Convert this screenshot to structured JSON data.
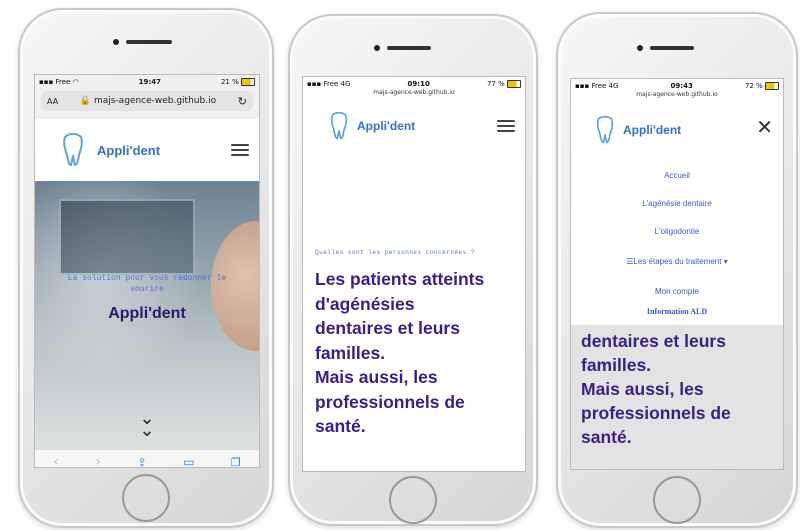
{
  "phone1": {
    "status": {
      "carrier": "Free",
      "time": "19:47",
      "battery": "21 %"
    },
    "address_bar": {
      "text_size": "AA",
      "url": "majs-agence-web.github.io"
    },
    "brand": "Appli'dent",
    "hero": {
      "tagline": "La solution pour vous redonner le sourire",
      "title": "Appli'dent"
    }
  },
  "phone2": {
    "status": {
      "carrier": "Free 4G",
      "time": "09:10",
      "battery": "77 %"
    },
    "url": "majs-agence-web.github.io",
    "brand": "Appli'dent",
    "kicker": "Quelles sont les personnes concernées ?",
    "heading": [
      "Les patients atteints",
      "d'agénésies",
      "dentaires et leurs",
      "familles.",
      "Mais aussi, les",
      "professionnels de",
      "santé."
    ]
  },
  "phone3": {
    "status": {
      "carrier": "Free 4G",
      "time": "09:43",
      "battery": "72 %"
    },
    "url": "majs-agence-web.github.io",
    "brand": "Appli'dent",
    "menu": [
      "Accueil",
      "L'agénésie dentaire",
      "L'oligodontie",
      "Les étapes du traitement",
      "Mon compte",
      "Information ALD"
    ],
    "heading": [
      "dentaires et leurs",
      "familles.",
      "Mais aussi, les",
      "professionnels de",
      "santé."
    ]
  },
  "colors": {
    "brand_blue": "#3a6fc7",
    "heading_purple": "#3a2189",
    "ios_blue": "#1a7cff"
  }
}
